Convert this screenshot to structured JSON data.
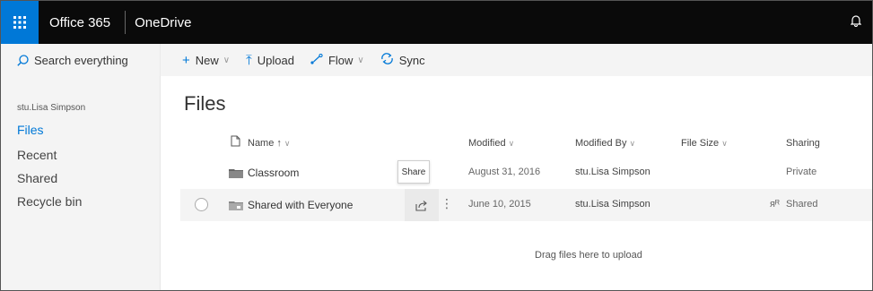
{
  "topbar": {
    "brand": "Office 365",
    "app_name": "OneDrive"
  },
  "search": {
    "placeholder": "Search everything"
  },
  "command_bar": {
    "new_label": "New",
    "upload_label": "Upload",
    "flow_label": "Flow",
    "sync_label": "Sync"
  },
  "sidebar": {
    "user": "stu.Lisa Simpson",
    "items": [
      {
        "label": "Files",
        "active": true
      },
      {
        "label": "Recent",
        "active": false
      },
      {
        "label": "Shared",
        "active": false
      },
      {
        "label": "Recycle bin",
        "active": false
      }
    ]
  },
  "main": {
    "title": "Files",
    "columns": {
      "name": "Name ↑",
      "modified": "Modified",
      "modified_by": "Modified By",
      "file_size": "File Size",
      "sharing": "Sharing"
    },
    "rows": [
      {
        "name": "Classroom",
        "modified": "August 31, 2016",
        "modified_by": "stu.Lisa Simpson",
        "sharing": "Private"
      },
      {
        "name": "Shared with Everyone",
        "modified": "June 10, 2015",
        "modified_by": "stu.Lisa Simpson",
        "sharing": "Shared"
      }
    ],
    "tooltip": "Share",
    "drop_hint": "Drag files here to upload"
  },
  "colors": {
    "accent": "#0078d7",
    "topbar_bg": "#0a0a0a",
    "pane_bg": "#f4f4f4"
  }
}
